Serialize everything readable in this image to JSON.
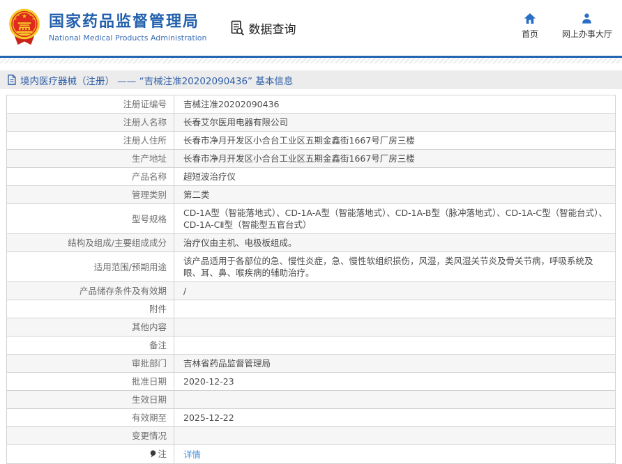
{
  "colors": {
    "brand_blue": "#2260ad",
    "nav_icon_blue": "#2a6fc4",
    "divider_blue": "#2265b1",
    "breadcrumb_text": "#2f5fa8",
    "link_blue": "#4b93dd",
    "emblem_red": "#de2b1c",
    "emblem_gold": "#f5c928"
  },
  "header": {
    "org_name_cn": "国家药品监督管理局",
    "org_name_en": "National Medical Products Administration",
    "section_title": "数据查询",
    "nav": [
      {
        "label": "首页",
        "icon": "home-icon"
      },
      {
        "label": "网上办事大厅",
        "icon": "person-icon"
      }
    ]
  },
  "breadcrumb": {
    "text": "境内医疗器械（注册） —— “吉械注准20202090436” 基本信息"
  },
  "table": {
    "rows": [
      {
        "label": "注册证编号",
        "value": "吉械注准20202090436"
      },
      {
        "label": "注册人名称",
        "value": "长春艾尔医用电器有限公司"
      },
      {
        "label": "注册人住所",
        "value": "长春市净月开发区小合台工业区五期金鑫街1667号厂房三楼"
      },
      {
        "label": "生产地址",
        "value": "长春市净月开发区小合台工业区五期金鑫街1667号厂房三楼"
      },
      {
        "label": "产品名称",
        "value": "超短波治疗仪"
      },
      {
        "label": "管理类别",
        "value": "第二类"
      },
      {
        "label": "型号规格",
        "value": "CD-1A型（智能落地式）、CD-1A-A型（智能落地式）、CD-1A-B型（脉冲落地式）、CD-1A-C型（智能台式）、CD-1A-CⅡ型（智能型五官台式）"
      },
      {
        "label": "结构及组成/主要组成成分",
        "value": "治疗仪由主机、电极板组成。"
      },
      {
        "label": "适用范围/预期用途",
        "value": "该产品适用于各部位的急、慢性炎症，急、慢性软组织损伤，风湿，类风湿关节炎及骨关节病，呼吸系统及眼、耳、鼻、喉疾病的辅助治疗。"
      },
      {
        "label": "产品储存条件及有效期",
        "value": "/"
      },
      {
        "label": "附件",
        "value": ""
      },
      {
        "label": "其他内容",
        "value": ""
      },
      {
        "label": "备注",
        "value": ""
      },
      {
        "label": "审批部门",
        "value": "吉林省药品监督管理局"
      },
      {
        "label": "批准日期",
        "value": "2020-12-23"
      },
      {
        "label": "生效日期",
        "value": ""
      },
      {
        "label": "有效期至",
        "value": "2025-12-22"
      },
      {
        "label": "变更情况",
        "value": ""
      },
      {
        "label": "注",
        "value": "详情",
        "link": true,
        "label_icon": "balloon-icon"
      }
    ]
  }
}
